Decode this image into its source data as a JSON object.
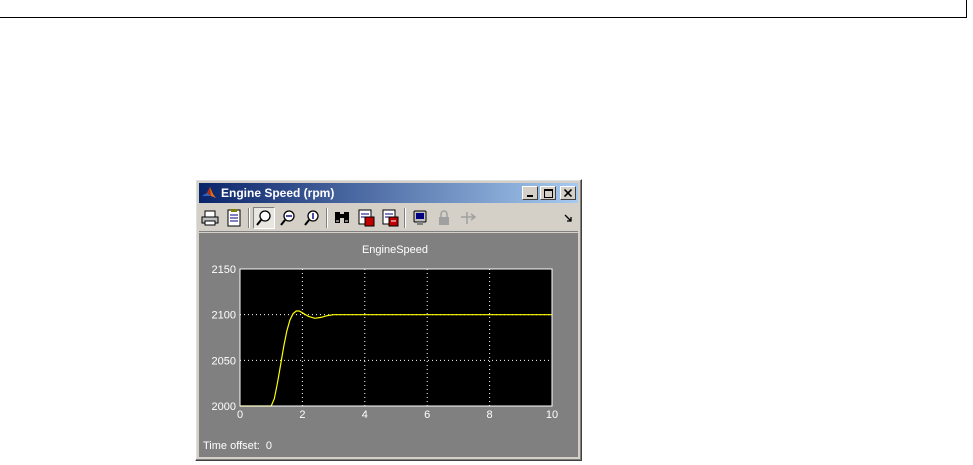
{
  "window": {
    "title": "Engine Speed (rpm)",
    "minimize_label": "_",
    "maximize_label": "□",
    "close_label": "×"
  },
  "toolbar": {
    "tools": [
      {
        "name": "print-icon"
      },
      {
        "name": "parameters-icon"
      },
      {
        "name": "zoom-icon",
        "pressed": true
      },
      {
        "name": "zoom-x-icon"
      },
      {
        "name": "zoom-y-icon"
      },
      {
        "name": "autoscale-binoculars-icon"
      },
      {
        "name": "save-axes-settings-icon"
      },
      {
        "name": "restore-axes-settings-icon"
      },
      {
        "name": "floating-scope-icon"
      },
      {
        "name": "lock-axes-icon"
      },
      {
        "name": "signal-selection-icon"
      }
    ]
  },
  "scope": {
    "time_offset_label": "Time offset:",
    "time_offset_value": "0"
  },
  "colors": {
    "plot_background": "#000000",
    "trace": "#ffff00",
    "frame": "#808080",
    "grid": "#ffffff"
  },
  "chart_data": {
    "type": "line",
    "title": "EngineSpeed",
    "xlabel": "",
    "ylabel": "",
    "xlim": [
      0,
      10
    ],
    "ylim": [
      2000,
      2150
    ],
    "xticks": [
      0,
      2,
      4,
      6,
      8,
      10
    ],
    "yticks": [
      2000,
      2050,
      2100,
      2150
    ],
    "grid": true,
    "series": [
      {
        "color": "#ffff00",
        "x": [
          0,
          0.5,
          1.0,
          1.1,
          1.2,
          1.3,
          1.4,
          1.5,
          1.6,
          1.7,
          1.8,
          1.9,
          2.0,
          2.2,
          2.4,
          2.6,
          2.8,
          3.0,
          3.2,
          3.5,
          4.0,
          5.0,
          6.0,
          7.0,
          8.0,
          9.0,
          10.0
        ],
        "y": [
          2000,
          2000,
          2000,
          2008,
          2025,
          2045,
          2065,
          2082,
          2094,
          2101,
          2104,
          2104,
          2102,
          2098,
          2096,
          2097,
          2099,
          2100,
          2100,
          2100,
          2100,
          2100,
          2100,
          2100,
          2100,
          2100,
          2100
        ]
      }
    ]
  }
}
